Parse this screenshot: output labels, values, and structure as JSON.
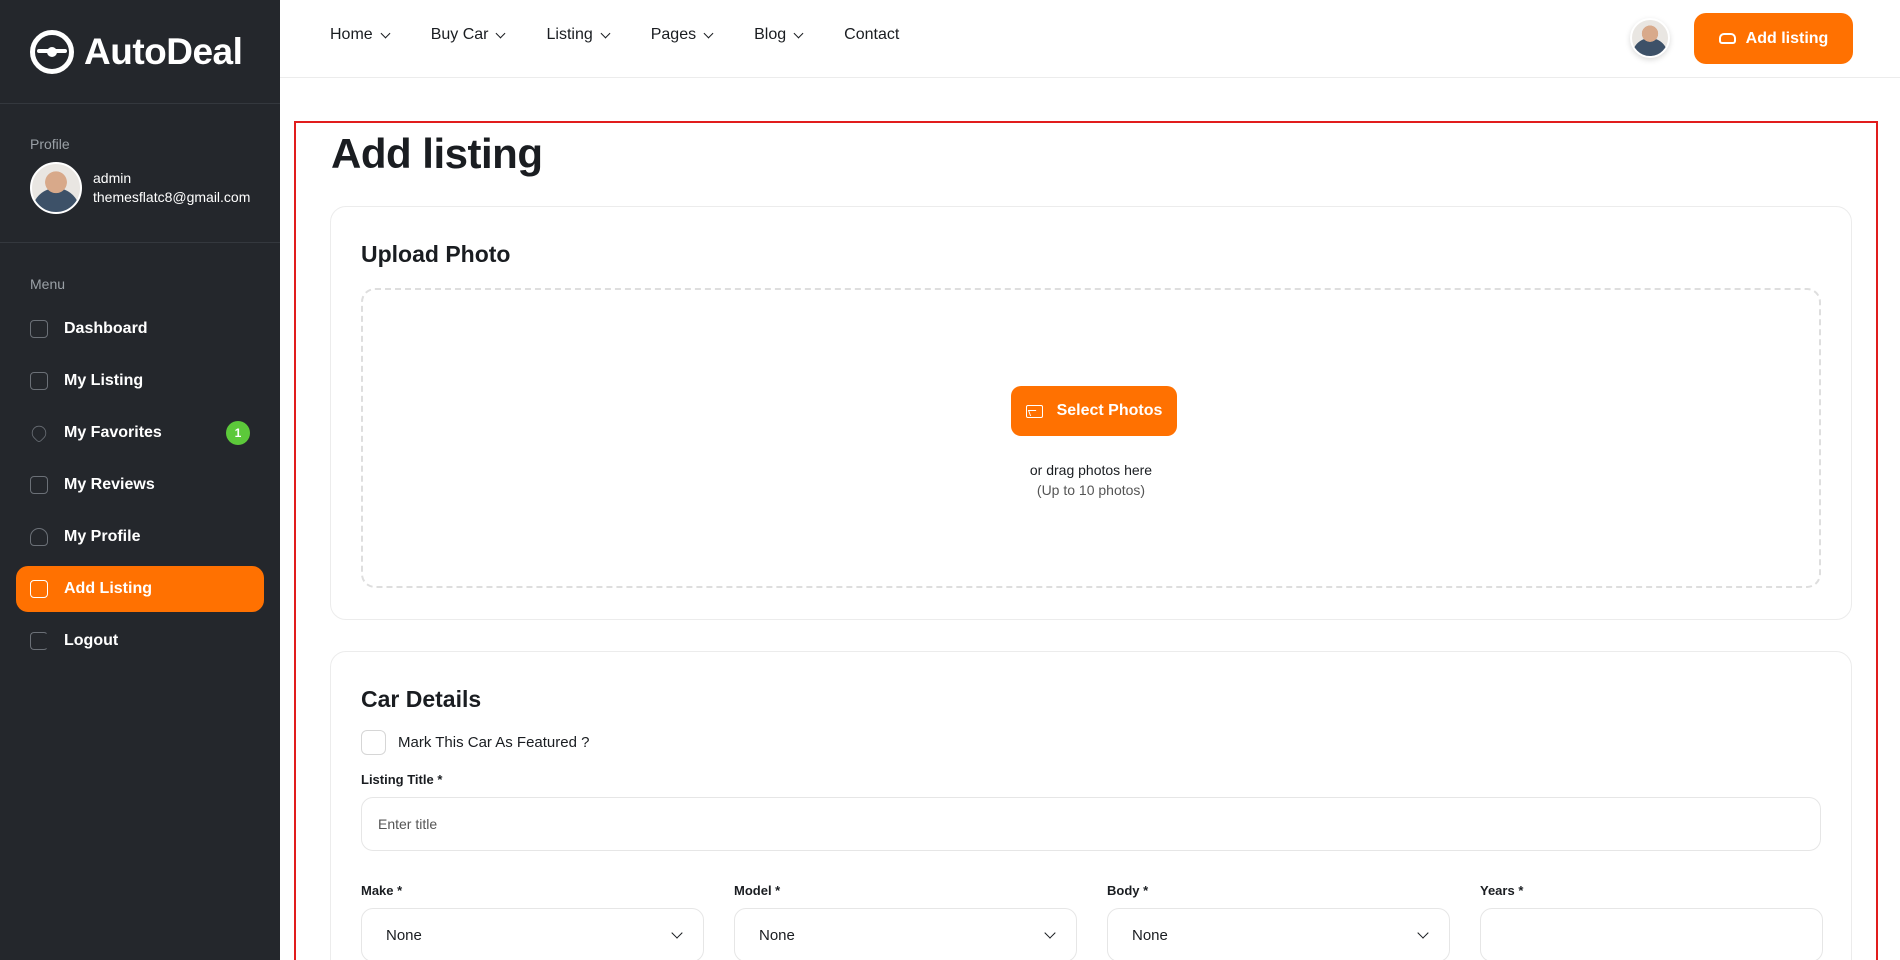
{
  "brand": {
    "name": "AutoDeal",
    "logo_icon": "steering-wheel-icon"
  },
  "sidebar": {
    "profile_label": "Profile",
    "user": {
      "name": "admin",
      "email": "themesflatc8@gmail.com"
    },
    "menu_label": "Menu",
    "items": [
      {
        "label": "Dashboard",
        "icon": "chart-icon"
      },
      {
        "label": "My Listing",
        "icon": "edit-icon"
      },
      {
        "label": "My Favorites",
        "icon": "heart-icon",
        "badge": "1"
      },
      {
        "label": "My Reviews",
        "icon": "mail-icon"
      },
      {
        "label": "My Profile",
        "icon": "user-icon"
      },
      {
        "label": "Add Listing",
        "icon": "edit-icon",
        "active": true
      },
      {
        "label": "Logout",
        "icon": "logout-icon"
      }
    ]
  },
  "topnav": {
    "items": [
      "Home",
      "Buy Car",
      "Listing",
      "Pages",
      "Blog",
      "Contact"
    ],
    "add_button": "Add listing"
  },
  "page": {
    "title": "Add listing",
    "upload": {
      "title": "Upload Photo",
      "button": "Select Photos",
      "drag_text": "or drag photos here",
      "limit_text": "(Up to 10 photos)"
    },
    "details": {
      "title": "Car Details",
      "featured_label": "Mark This Car As Featured ?",
      "listing_title_label": "Listing Title *",
      "listing_title_placeholder": "Enter title",
      "fields": [
        {
          "label": "Make *",
          "value": "None"
        },
        {
          "label": "Model *",
          "value": "None"
        },
        {
          "label": "Body *",
          "value": "None"
        },
        {
          "label": "Years *",
          "value": ""
        }
      ]
    }
  },
  "colors": {
    "accent": "#ff7101",
    "sidebar_bg": "#24272c",
    "badge": "#5cc93a",
    "highlight_frame": "#e11d1d"
  }
}
